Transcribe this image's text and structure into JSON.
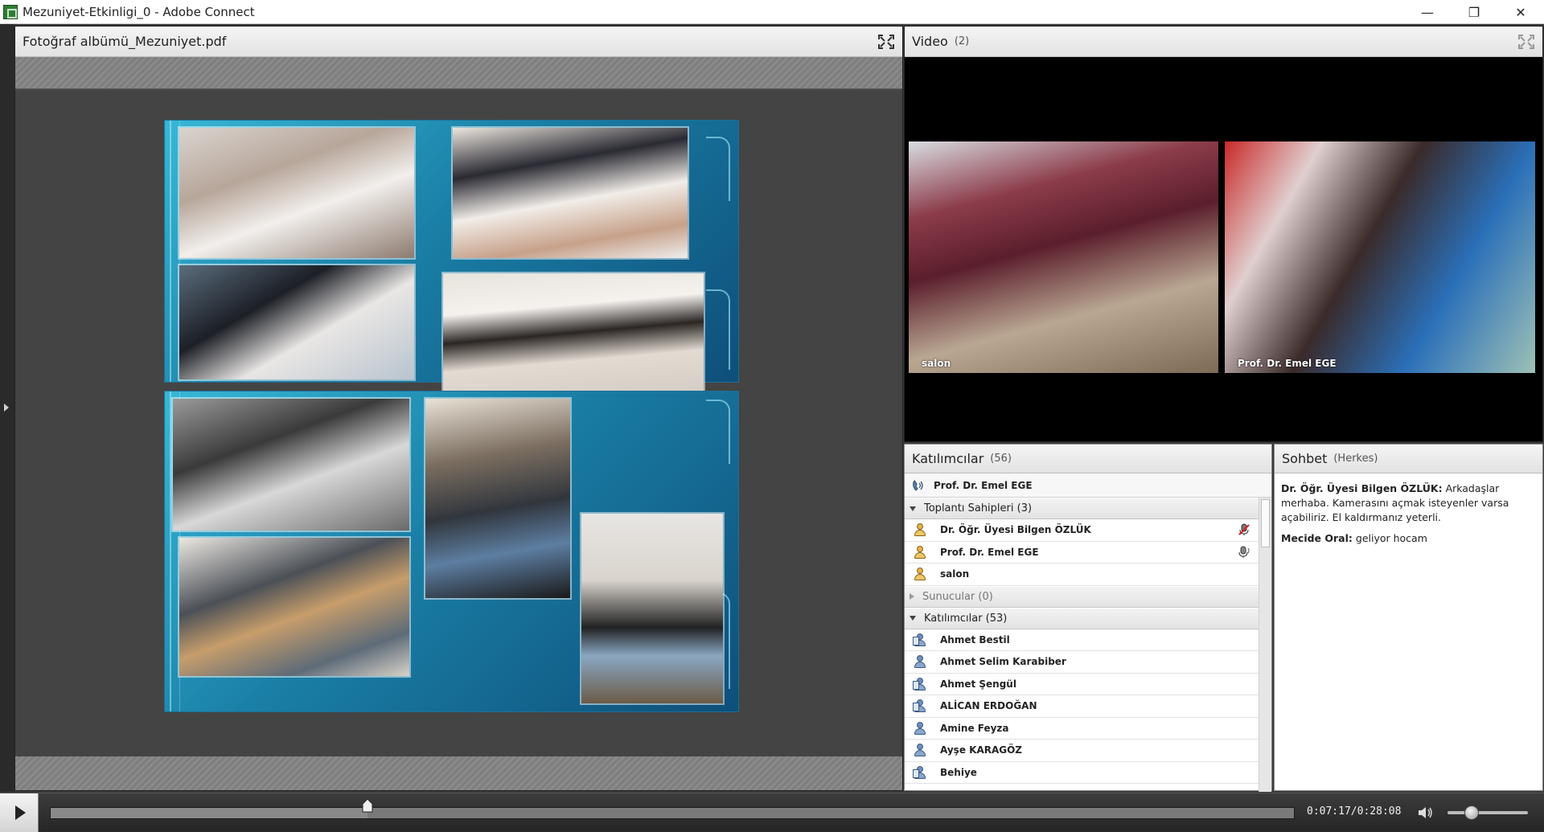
{
  "window": {
    "title": "Mezuniyet-Etkinligi_0 - Adobe Connect",
    "minimize": "—",
    "maximize": "❐",
    "close": "✕"
  },
  "share_pod": {
    "title": "Fotoğraf albümü_Mezuniyet.pdf"
  },
  "video_pod": {
    "title": "Video",
    "count": "(2)",
    "tiles": [
      {
        "label": "salon"
      },
      {
        "label": "Prof. Dr. Emel EGE"
      }
    ]
  },
  "attendees_pod": {
    "title": "Katılımcılar",
    "count": "(56)",
    "active_speaker": "Prof. Dr. Emel EGE",
    "groups": {
      "hosts": "Toplantı Sahipleri (3)",
      "presenters": "Sunucular (0)",
      "participants": "Katılımcılar (53)"
    },
    "hosts": [
      {
        "name": "Dr. Öğr. Üyesi Bilgen ÖZLÜK",
        "status": "mic-muted-icon"
      },
      {
        "name": "Prof. Dr. Emel EGE",
        "status": "mic-active-icon"
      },
      {
        "name": "salon",
        "status": ""
      }
    ],
    "participants": [
      {
        "name": "Ahmet Bestil"
      },
      {
        "name": "Ahmet Selim Karabiber"
      },
      {
        "name": "Ahmet Şengül"
      },
      {
        "name": "ALİCAN ERDOĞAN"
      },
      {
        "name": "Amine Feyza"
      },
      {
        "name": "Ayşe KARAGÖZ"
      },
      {
        "name": "Behiye"
      }
    ]
  },
  "chat_pod": {
    "title": "Sohbet",
    "scope": "(Herkes)",
    "messages": [
      {
        "from": "Dr. Öğr. Üyesi Bilgen ÖZLÜK:",
        "text": " Arkadaşlar merhaba. Kamerasını açmak isteyenler varsa açabiliriz. El kaldırmanız yeterli."
      },
      {
        "from": "Mecide Oral:",
        "text": " geliyor hocam"
      }
    ]
  },
  "playback": {
    "time": "0:07:17/0:28:08",
    "progress": 0.255,
    "volume": 0.3
  },
  "colors": {
    "slide_bg_light": "#38b7d6",
    "slide_bg_dark": "#0e4f7a",
    "host_icon": "#e6b34c",
    "participant_icon": "#6f8fb8"
  }
}
